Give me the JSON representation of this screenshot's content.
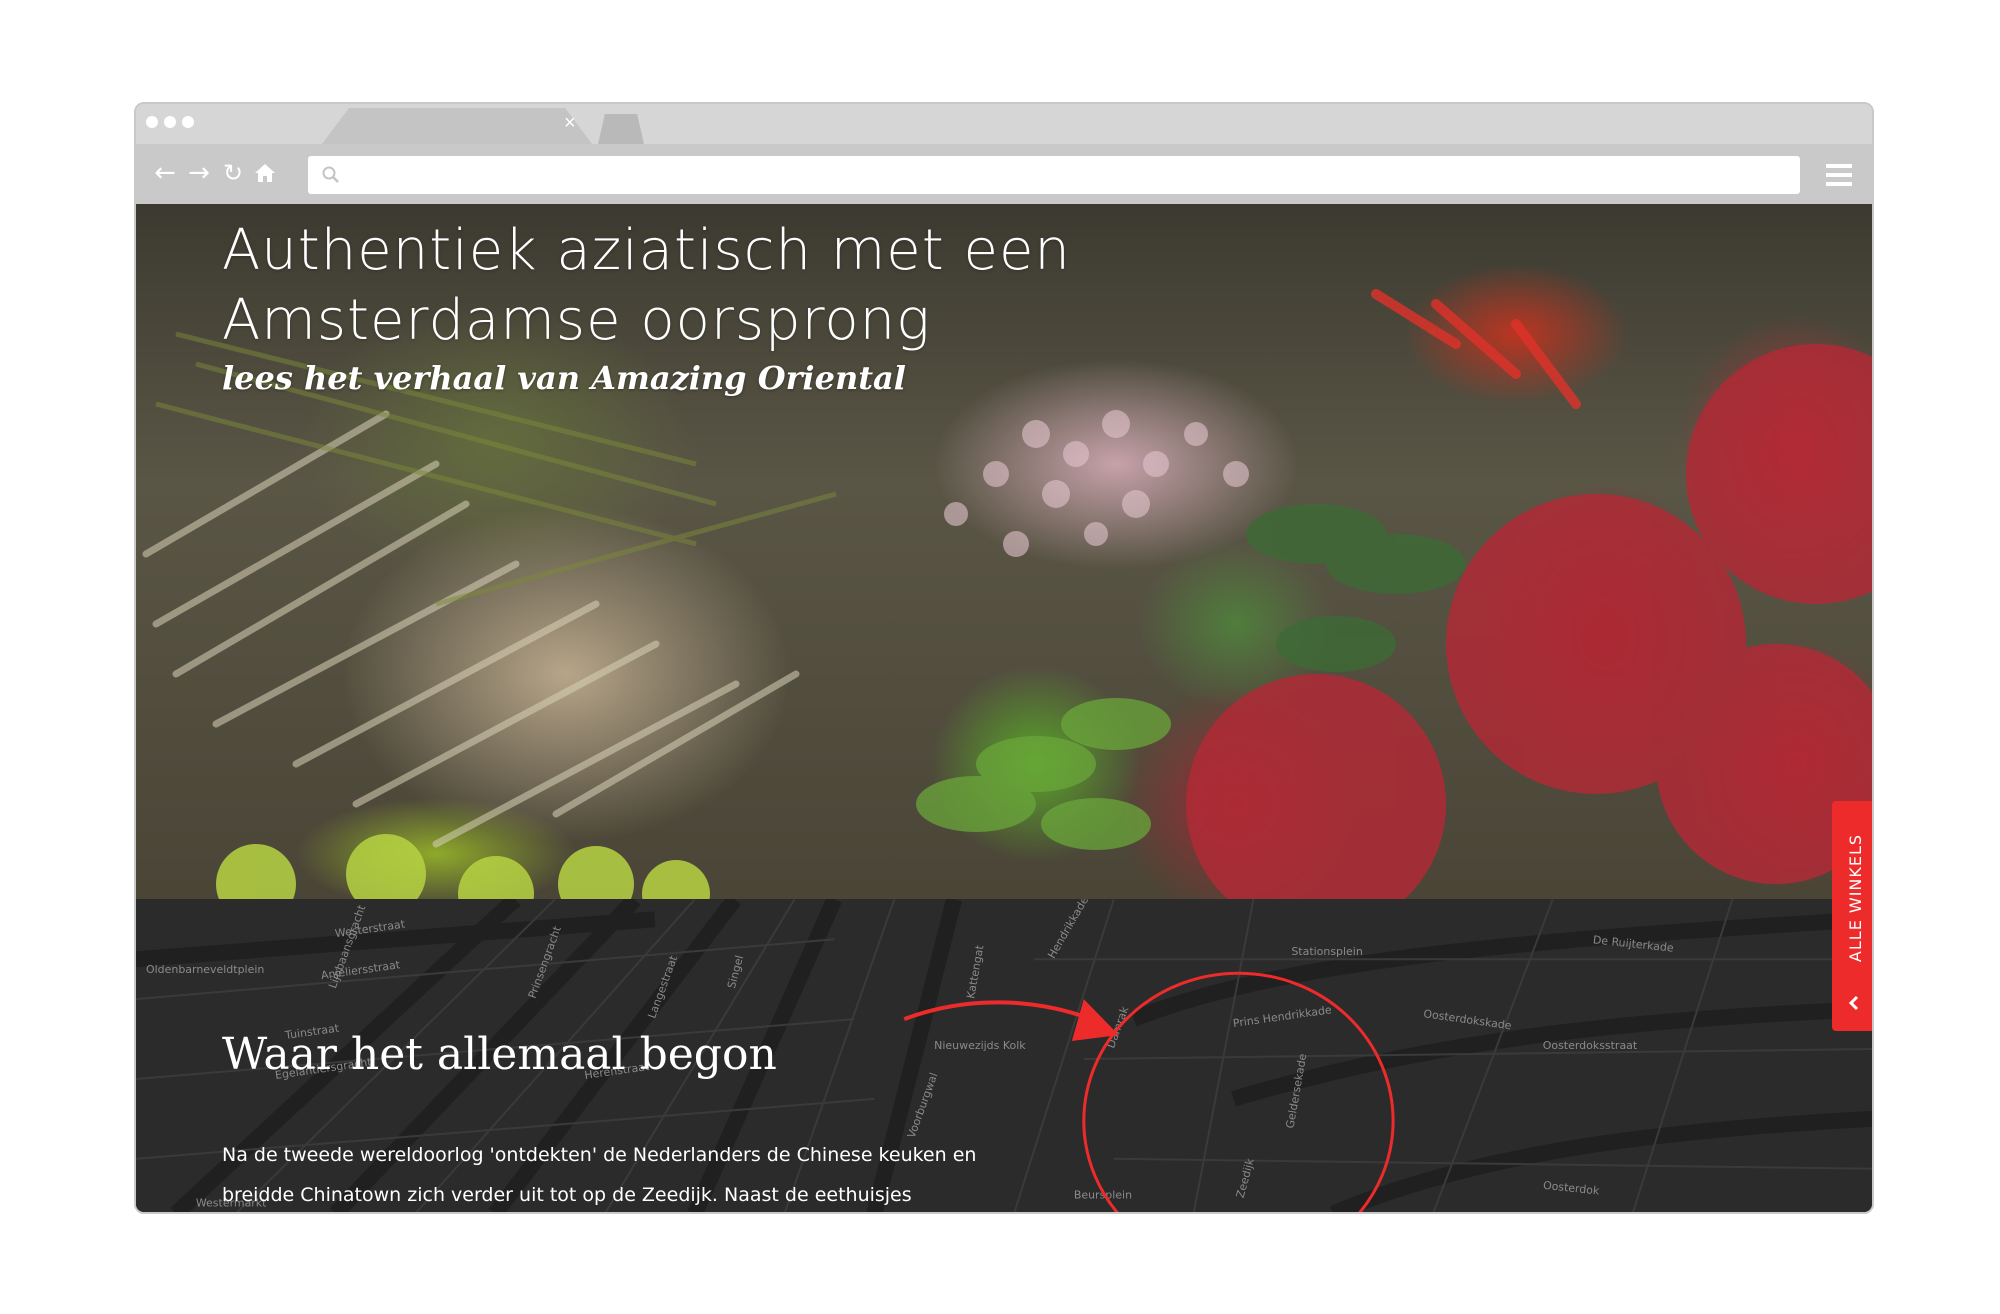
{
  "browser": {
    "tab_close": "×",
    "url": ""
  },
  "hero": {
    "title": "Authentiek aziatisch met een Amsterdamse oorsprong",
    "subtitle": "lees het verhaal van Amazing Oriental"
  },
  "story": {
    "title": "Waar het allemaal begon",
    "text": "Na de tweede wereldoorlog 'ontdekten' de Nederlanders de Chinese keuken en breidde Chinatown zich verder uit tot op de Zeedijk. Naast de eethuisjes"
  },
  "side_tab": {
    "label": "ALLE WINKELS"
  },
  "map": {
    "street_labels": [
      "Westerstraat",
      "Oldenbarneveldtplein",
      "Anjeliersstraat",
      "Tuinstraat",
      "Egelantiersgracht",
      "Lijnbaansgracht",
      "Prinsengracht",
      "Herenstraat",
      "Langestraat",
      "Singel",
      "Kattengat",
      "Hendrikkade",
      "Stationsplein",
      "Prins Hendrikkade",
      "De Ruijterkade",
      "Oosterdokskade",
      "Oosterdoksstraat",
      "Nieuwezijds Kolk",
      "Damrak",
      "Geldersekade",
      "Zeedijk",
      "Westermarkt",
      "Voorburgwal",
      "Oosterdok",
      "Beursplein"
    ]
  },
  "colors": {
    "accent": "#ee2b2b",
    "chrome": "#d6d6d6",
    "story_bg": "#2b2b2b"
  }
}
